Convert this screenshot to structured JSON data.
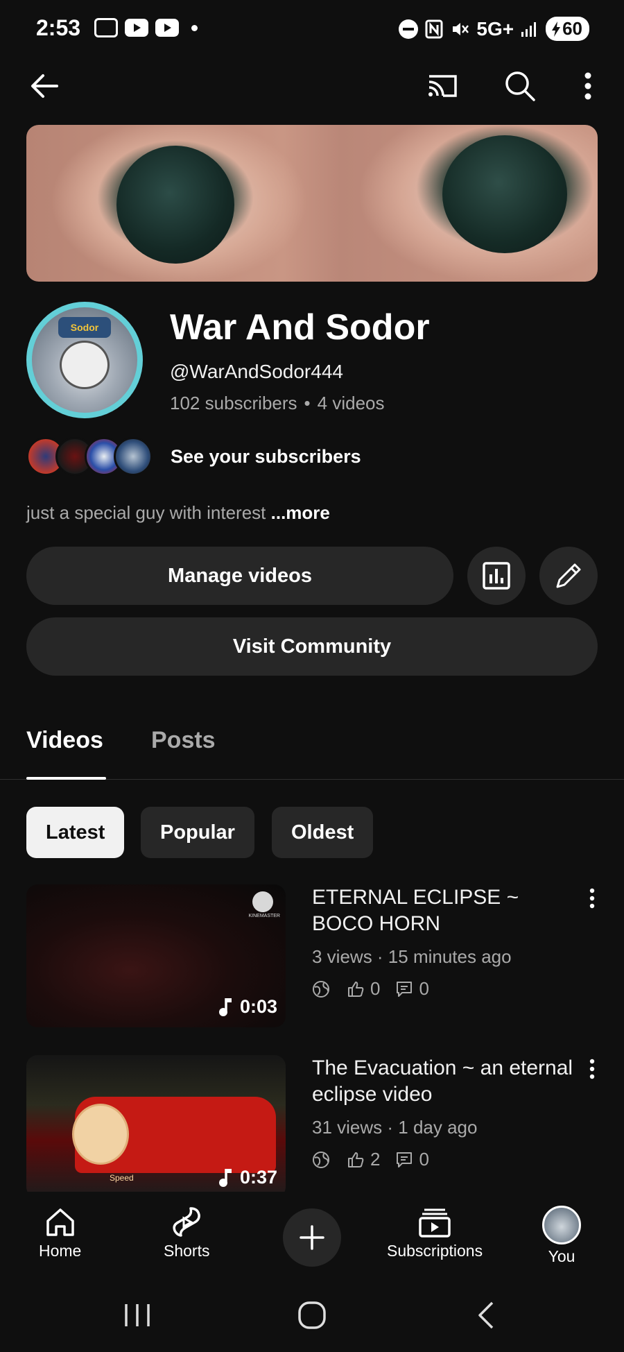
{
  "status_bar": {
    "time": "2:53",
    "network": "5G+",
    "battery": "60"
  },
  "appbar": {
    "back_icon": "arrow-left-icon",
    "cast_icon": "cast-icon",
    "search_icon": "search-icon",
    "more_icon": "more-vert-icon"
  },
  "channel": {
    "name": "War And Sodor",
    "handle": "@WarAndSodor444",
    "subscribers": "102 subscribers",
    "separator": "•",
    "videos": "4 videos",
    "avatar_badge": "Sodor",
    "see_subscribers": "See your subscribers",
    "description": "just a special guy with interest",
    "more": "...more"
  },
  "actions": {
    "manage_videos": "Manage videos",
    "visit_community": "Visit Community",
    "analytics_icon": "analytics-icon",
    "edit_icon": "pencil-icon"
  },
  "tabs": [
    {
      "label": "Videos",
      "active": true
    },
    {
      "label": "Posts",
      "active": false
    }
  ],
  "chips": [
    {
      "label": "Latest",
      "selected": true
    },
    {
      "label": "Popular",
      "selected": false
    },
    {
      "label": "Oldest",
      "selected": false
    }
  ],
  "videos": [
    {
      "title": "ETERNAL ECLIPSE ~ BOCO HORN",
      "meta": "3 views · 15 minutes ago",
      "likes": "0",
      "comments": "0",
      "duration": "0:03",
      "watermark": "KINEMASTER"
    },
    {
      "title": "The Evacuation ~ an eternal eclipse video",
      "meta": "31 views · 1 day ago",
      "likes": "2",
      "comments": "0",
      "duration": "0:37",
      "watermark": "Speed"
    }
  ],
  "bottom_nav": [
    {
      "label": "Home",
      "icon": "home-icon"
    },
    {
      "label": "Shorts",
      "icon": "shorts-icon"
    },
    {
      "label": "",
      "icon": "plus-icon"
    },
    {
      "label": "Subscriptions",
      "icon": "subscriptions-icon"
    },
    {
      "label": "You",
      "icon": "avatar"
    }
  ]
}
